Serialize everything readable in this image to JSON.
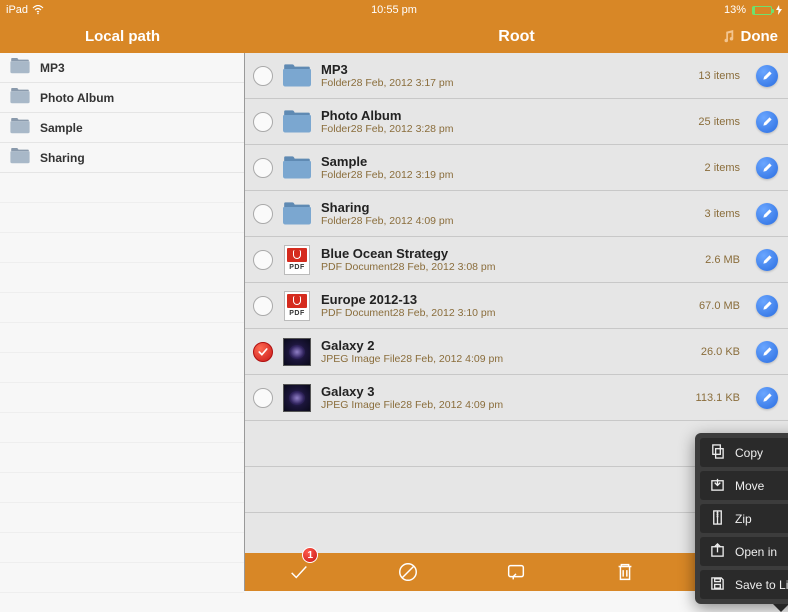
{
  "status": {
    "device": "iPad",
    "time": "10:55 pm",
    "battery_pct": "13%"
  },
  "nav": {
    "left_title": "Local path",
    "right_title": "Root",
    "done": "Done"
  },
  "sidebar": {
    "items": [
      {
        "label": "MP3"
      },
      {
        "label": "Photo Album"
      },
      {
        "label": "Sample"
      },
      {
        "label": "Sharing"
      }
    ]
  },
  "files": [
    {
      "name": "MP3",
      "type": "Folder",
      "date": "28 Feb, 2012 3:17 pm",
      "size": "13 items",
      "icon": "folder",
      "checked": false
    },
    {
      "name": "Photo Album",
      "type": "Folder",
      "date": "28 Feb, 2012 3:28 pm",
      "size": "25 items",
      "icon": "folder",
      "checked": false
    },
    {
      "name": "Sample",
      "type": "Folder",
      "date": "28 Feb, 2012 3:19 pm",
      "size": "2 items",
      "icon": "folder",
      "checked": false
    },
    {
      "name": "Sharing",
      "type": "Folder",
      "date": "28 Feb, 2012 4:09 pm",
      "size": "3 items",
      "icon": "folder",
      "checked": false
    },
    {
      "name": "Blue Ocean Strategy",
      "type": "PDF Document",
      "date": "28 Feb, 2012 3:08 pm",
      "size": "2.6 MB",
      "icon": "pdf",
      "checked": false
    },
    {
      "name": "Europe 2012-13",
      "type": "PDF Document",
      "date": "28 Feb, 2012 3:10 pm",
      "size": "67.0 MB",
      "icon": "pdf",
      "checked": false
    },
    {
      "name": "Galaxy 2",
      "type": "JPEG Image File",
      "date": "28 Feb, 2012 4:09 pm",
      "size": "26.0 KB",
      "icon": "image",
      "checked": true
    },
    {
      "name": "Galaxy 3",
      "type": "JPEG Image File",
      "date": "28 Feb, 2012 4:09 pm",
      "size": "113.1 KB",
      "icon": "image",
      "checked": false
    }
  ],
  "popup": {
    "items": [
      {
        "label": "Copy",
        "icon": "copy"
      },
      {
        "label": "Move",
        "icon": "move"
      },
      {
        "label": "Zip",
        "icon": "zip"
      },
      {
        "label": "Open in",
        "icon": "openin"
      },
      {
        "label": "Save to Library",
        "icon": "save"
      }
    ]
  },
  "toolbar": {
    "badge": "1"
  }
}
